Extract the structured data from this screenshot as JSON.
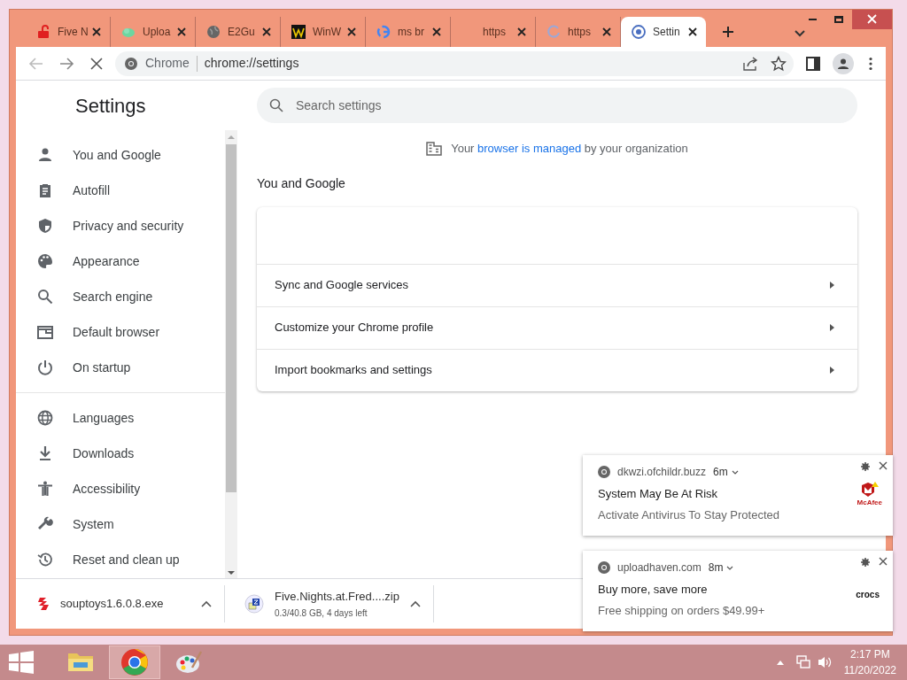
{
  "tabs": [
    {
      "title": "Five N",
      "kind": "lock",
      "selected": false
    },
    {
      "title": "Uploa",
      "kind": "cloud",
      "selected": false
    },
    {
      "title": "E2Gu",
      "kind": "globe",
      "selected": false
    },
    {
      "title": "WinW",
      "kind": "w",
      "selected": false
    },
    {
      "title": "ms br",
      "kind": "google",
      "selected": false
    },
    {
      "title": "https",
      "kind": "none",
      "selected": false
    },
    {
      "title": "https",
      "kind": "spinner",
      "selected": false
    },
    {
      "title": "Settin",
      "kind": "gear",
      "selected": true
    }
  ],
  "toolbar": {
    "site_label": "Chrome",
    "url": "chrome://settings"
  },
  "settings": {
    "title": "Settings",
    "search": {
      "placeholder": "Search settings"
    },
    "nav_groups": [
      [
        {
          "label": "You and Google",
          "kind": "person"
        },
        {
          "label": "Autofill",
          "kind": "clipboard"
        },
        {
          "label": "Privacy and security",
          "kind": "shield"
        },
        {
          "label": "Appearance",
          "kind": "palette"
        },
        {
          "label": "Search engine",
          "kind": "search"
        },
        {
          "label": "Default browser",
          "kind": "browser"
        },
        {
          "label": "On startup",
          "kind": "power"
        }
      ],
      [
        {
          "label": "Languages",
          "kind": "globe"
        },
        {
          "label": "Downloads",
          "kind": "download"
        },
        {
          "label": "Accessibility",
          "kind": "accessibility"
        },
        {
          "label": "System",
          "kind": "wrench"
        },
        {
          "label": "Reset and clean up",
          "kind": "history"
        }
      ]
    ],
    "managed_notice": {
      "before": "Your",
      "link": "browser is managed",
      "after": "by your organization"
    },
    "section_title": "You and Google",
    "card_rows": [
      "Sync and Google services",
      "Customize your Chrome profile",
      "Import bookmarks and settings"
    ]
  },
  "downloads": [
    {
      "name": "souptoys1.6.0.8.exe",
      "kind": "exe"
    },
    {
      "name": "Five.Nights.at.Fred....zip",
      "status": "0.3/40.8 GB, 4 days left",
      "kind": "zip"
    }
  ],
  "notifications": [
    {
      "site": "dkwzi.ofchildr.buzz",
      "age": "6m",
      "title": "System May Be At Risk",
      "body": "Activate Antivirus To Stay Protected",
      "brand": "McAfee",
      "kind": "shield-logo"
    },
    {
      "site": "uploadhaven.com",
      "age": "8m",
      "title": "Buy more, save more",
      "body": "Free shipping on orders $49.99+",
      "brand": "crocs",
      "kind": "wordmark"
    }
  ],
  "taskbar": {
    "apps": [
      {
        "kind": "folder",
        "selected": false
      },
      {
        "kind": "chrome",
        "selected": true
      },
      {
        "kind": "paint",
        "selected": false
      }
    ],
    "time": "2:17 PM",
    "date": "11/20/2022"
  }
}
